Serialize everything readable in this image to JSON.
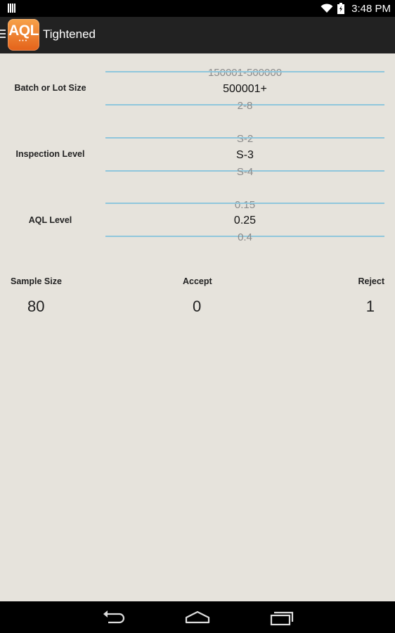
{
  "status": {
    "time": "3:48 PM"
  },
  "app": {
    "title": "Tightened",
    "logo_text": "AQL",
    "logo_dots": "•••"
  },
  "pickers": [
    {
      "label": "Batch or Lot Size",
      "prev": "150001-500000",
      "selected": "500001+",
      "next": "2-8"
    },
    {
      "label": "Inspection Level",
      "prev": "S-2",
      "selected": "S-3",
      "next": "S-4"
    },
    {
      "label": "AQL Level",
      "prev": "0.15",
      "selected": "0.25",
      "next": "0.4"
    }
  ],
  "results": {
    "sample_size_label": "Sample Size",
    "sample_size": "80",
    "accept_label": "Accept",
    "accept": "0",
    "reject_label": "Reject",
    "reject": "1"
  },
  "icons": {
    "signal": "signal-bars-icon",
    "wifi": "wifi-icon",
    "battery": "battery-icon",
    "drawer": "drawer-menu-icon",
    "back": "back-icon",
    "home": "home-icon",
    "recents": "recents-icon"
  },
  "colors": {
    "picker_line": "#8fc6dc",
    "logo": "#f08a36",
    "background": "#e6e3dc"
  }
}
